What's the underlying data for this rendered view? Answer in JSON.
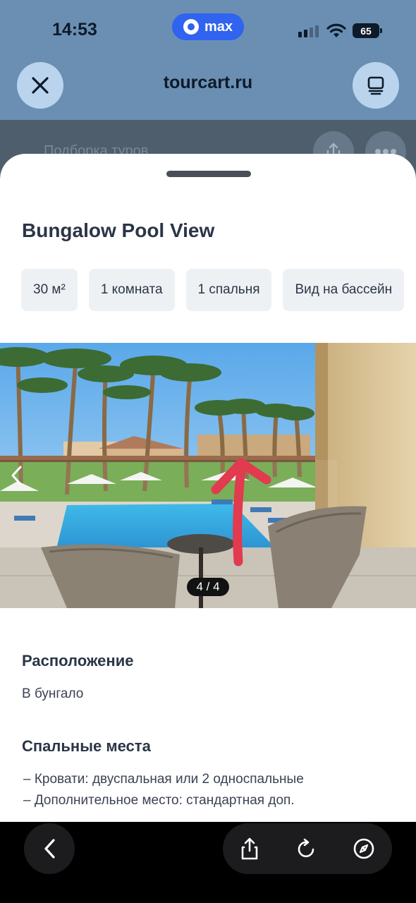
{
  "status_bar": {
    "time": "14:53",
    "messenger_pill": "max",
    "battery": "65"
  },
  "browser": {
    "url": "tourcart.ru"
  },
  "background_page": {
    "title": "Подборка туров"
  },
  "room": {
    "title": "Bungalow Pool View",
    "features": [
      "30 м²",
      "1 комната",
      "1 спальня",
      "Вид на бассейн"
    ],
    "gallery": {
      "counter": "4 / 4"
    },
    "location": {
      "heading": "Расположение",
      "value": "В бунгало"
    },
    "sleeping": {
      "heading": "Спальные места",
      "items": [
        "– Кровати: двуспальная или 2 односпальные",
        "– Дополнительное место: стандартная доп."
      ]
    }
  },
  "colors": {
    "chrome": "#6a8fb3",
    "circle_button": "#b9d4ec",
    "messenger_accent": "#2f63f0",
    "chip_bg": "#eef1f4",
    "text": "#2c3547",
    "annotation_arrow": "#e23a4f"
  },
  "icons": {
    "close": "close-icon",
    "tabs": "tabs-icon",
    "share": "share-icon",
    "more": "more-icon",
    "back": "chevron-left-icon",
    "reload": "reload-icon",
    "compass": "compass-icon"
  }
}
